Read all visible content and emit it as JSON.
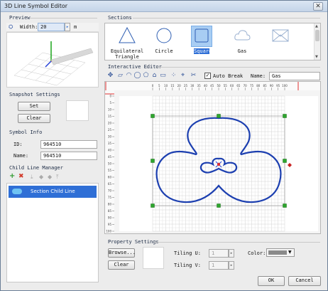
{
  "window": {
    "title": "3D Line Symbol Editor"
  },
  "preview": {
    "title": "Preview",
    "width_label": "Width:",
    "width_value": "20",
    "unit": "m"
  },
  "snapshot": {
    "title": "Snapshot Settings",
    "set_label": "Set",
    "clear_label": "Clear"
  },
  "symbol_info": {
    "title": "Symbol Info",
    "id_label": "ID:",
    "id_value": "964510",
    "name_label": "Name:",
    "name_value": "964510"
  },
  "child_manager": {
    "title": "Child Line Manager",
    "items": [
      {
        "label": "Section Child Line"
      }
    ]
  },
  "sections": {
    "title": "Sections",
    "items": [
      {
        "label": "Equilateral Triangle",
        "icon": "triangle-icon"
      },
      {
        "label": "Circle",
        "icon": "circle-icon"
      },
      {
        "label": "Square",
        "icon": "square-icon",
        "selected": true
      },
      {
        "label": "Gas",
        "icon": "cloud-icon"
      },
      {
        "label": "",
        "icon": "envelope-icon"
      }
    ]
  },
  "editor": {
    "title": "Interactive Editor",
    "auto_break_label": "Auto Break",
    "auto_break_checked": true,
    "name_label": "Name:",
    "name_value": "Gas",
    "ruler_top": [
      "0",
      "5",
      "10",
      "15",
      "20",
      "25",
      "30",
      "35",
      "40",
      "45",
      "50",
      "55",
      "60",
      "65",
      "70",
      "75",
      "80",
      "85",
      "90",
      "95",
      "100"
    ],
    "ruler_left": [
      "0",
      "5",
      "10",
      "15",
      "20",
      "25",
      "30",
      "35",
      "40",
      "45",
      "50",
      "55",
      "60",
      "65",
      "70",
      "75",
      "80",
      "85",
      "90",
      "95",
      "100"
    ]
  },
  "property": {
    "title": "Property Settings",
    "browse_label": "Browse...",
    "clear_label": "Clear",
    "tiling_u_label": "Tiling U:",
    "tiling_u_value": "1",
    "tiling_v_label": "Tiling V:",
    "tiling_v_value": "1",
    "color_label": "Color:"
  },
  "footer": {
    "ok_label": "OK",
    "cancel_label": "Cancel"
  },
  "colors": {
    "accent": "#2f6fd6",
    "shape": "#1c3fb0",
    "selection": "#a8cdf3"
  }
}
